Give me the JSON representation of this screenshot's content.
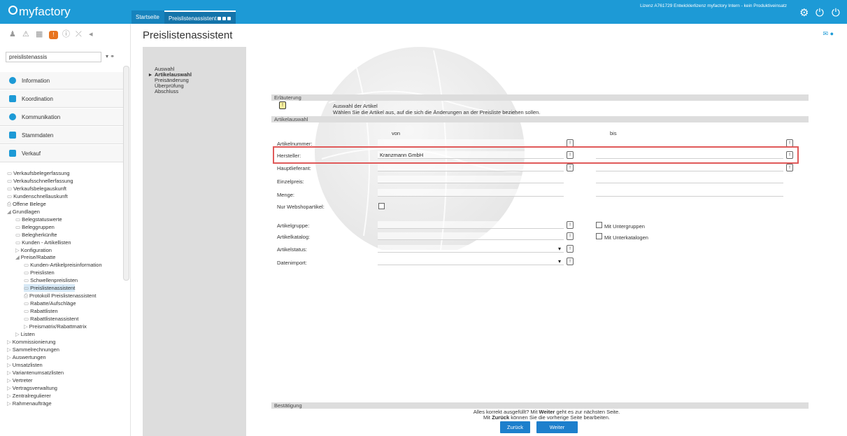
{
  "app": {
    "logo_text": "myfactory",
    "license_text": "Lizenz A761729 Entwicklerlizenz myfactory Intern - kein Produktiveinsatz"
  },
  "tabs": [
    {
      "label": "Startseite"
    },
    {
      "label": "Preislistenassistent"
    }
  ],
  "top_icons": [
    "gear-icon",
    "power-icon",
    "logout-icon"
  ],
  "sidebar": {
    "search_value": "preislistenassis",
    "sections": [
      {
        "label": "Information",
        "icon": "info-icon"
      },
      {
        "label": "Koordination",
        "icon": "coordination-icon"
      },
      {
        "label": "Kommunikation",
        "icon": "chat-icon"
      },
      {
        "label": "Stammdaten",
        "icon": "database-icon"
      },
      {
        "label": "Verkauf",
        "icon": "sales-icon"
      }
    ],
    "tree": [
      {
        "label": "Verkaufsbelegerfassung",
        "indent": 0,
        "icon": "▭"
      },
      {
        "label": "Verkaufsschnellerfassung",
        "indent": 0,
        "icon": "▭"
      },
      {
        "label": "Verkaufsbelegauskunft",
        "indent": 0,
        "icon": "▭"
      },
      {
        "label": "Kundenschnellauskunft",
        "indent": 0,
        "icon": "▭"
      },
      {
        "label": "Offene Belege",
        "indent": 0,
        "icon": "⎙"
      },
      {
        "label": "Grundlagen",
        "indent": 0,
        "icon": "◢"
      },
      {
        "label": "Belegstatuswerte",
        "indent": 1,
        "icon": "▭"
      },
      {
        "label": "Beleggruppen",
        "indent": 1,
        "icon": "▭"
      },
      {
        "label": "Belegherkünfte",
        "indent": 1,
        "icon": "▭"
      },
      {
        "label": "Kunden - Artikellisten",
        "indent": 1,
        "icon": "▭"
      },
      {
        "label": "Konfiguration",
        "indent": 1,
        "icon": "▷"
      },
      {
        "label": "Preise/Rabatte",
        "indent": 1,
        "icon": "◢"
      },
      {
        "label": "Kunden-Artikelpreisinformation",
        "indent": 2,
        "icon": "▭"
      },
      {
        "label": "Preislisten",
        "indent": 2,
        "icon": "▭"
      },
      {
        "label": "Schwellenpreislisten",
        "indent": 2,
        "icon": "▭"
      },
      {
        "label": "Preislistenassistent",
        "indent": 2,
        "icon": "▭",
        "selected": true
      },
      {
        "label": "Protokoll Preislistenassistent",
        "indent": 2,
        "icon": "⎙"
      },
      {
        "label": "Rabatte/Aufschläge",
        "indent": 2,
        "icon": "▭"
      },
      {
        "label": "Rabattlisten",
        "indent": 2,
        "icon": "▭"
      },
      {
        "label": "Rabattlistenassistent",
        "indent": 2,
        "icon": "▭"
      },
      {
        "label": "Preismatrix/Rabattmatrix",
        "indent": 2,
        "icon": "▷"
      },
      {
        "label": "Listen",
        "indent": 1,
        "icon": "▷"
      },
      {
        "label": "Kommissionierung",
        "indent": 0,
        "icon": "▷"
      },
      {
        "label": "Sammelrechnungen",
        "indent": 0,
        "icon": "▷"
      },
      {
        "label": "Auswertungen",
        "indent": 0,
        "icon": "▷"
      },
      {
        "label": "Umsatzlisten",
        "indent": 0,
        "icon": "▷"
      },
      {
        "label": "Variantenumsatzlisten",
        "indent": 0,
        "icon": "▷"
      },
      {
        "label": "Vertreter",
        "indent": 0,
        "icon": "▷"
      },
      {
        "label": "Vertragsverwaltung",
        "indent": 0,
        "icon": "▷"
      },
      {
        "label": "Zentralregulierer",
        "indent": 0,
        "icon": "▷"
      },
      {
        "label": "Rahmenaufträge",
        "indent": 0,
        "icon": "▷"
      }
    ]
  },
  "page": {
    "title": "Preislistenassistent"
  },
  "wizard_steps": [
    {
      "label": "Auswahl",
      "active": false
    },
    {
      "label": "Artikelauswahl",
      "active": true
    },
    {
      "label": "Preisänderung",
      "active": false
    },
    {
      "label": "Überprüfung",
      "active": false
    },
    {
      "label": "Abschluss",
      "active": false
    }
  ],
  "form": {
    "erlaeuterung_title": "Erläuterung",
    "erlaeuterung_line1": "Auswahl der Artikel",
    "erlaeuterung_line2": "Wählen Sie die Artikel aus, auf die sich die Änderungen an der Preisliste beziehen sollen.",
    "artikelauswahl_title": "Artikelauswahl",
    "col_von": "von",
    "col_bis": "bis",
    "artikelnummer_label": "Artikelnummer:",
    "hersteller_label": "Hersteller:",
    "hersteller_von": "Kranzmann GmbH",
    "hauptlieferant_label": "Hauptlieferant:",
    "einzelpreis_label": "Einzelpreis:",
    "menge_label": "Menge:",
    "webshop_label": "Nur Webshopartikel:",
    "artikelgruppe_label": "Artikelgruppe:",
    "mit_untergruppen": "Mit Untergruppen",
    "artikelkatalog_label": "Artikelkatalog:",
    "mit_unterkatalogen": "Mit Unterkatalogen",
    "artikelstatus_label": "Artikelstatus:",
    "datenimport_label": "Datenimport:",
    "info_btn": "!",
    "bestaetigung_title": "Bestätigung",
    "confirm_pre1": "Alles korrekt ausgefüllt?  Mit ",
    "confirm_bold1": "Weiter",
    "confirm_post1": " geht es zur nächsten Seite.",
    "confirm_pre2": "Mit ",
    "confirm_bold2": "Zurück",
    "confirm_post2": " können Sie die vorherige Seite bearbeiten.",
    "btn_back": "Zurück",
    "btn_next": "Weiter"
  }
}
